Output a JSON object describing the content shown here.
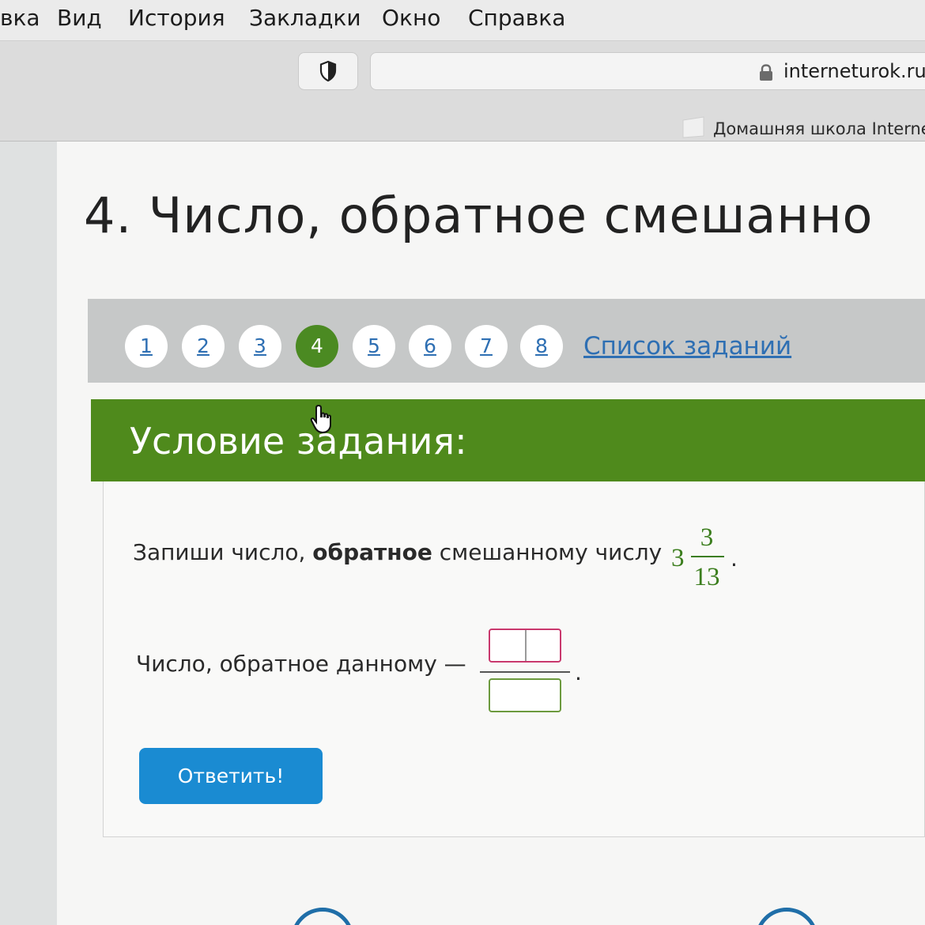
{
  "menubar": {
    "items": [
      "вка",
      "Вид",
      "История",
      "Закладки",
      "Окно",
      "Справка"
    ]
  },
  "browser": {
    "url": "interneturok.ru",
    "bookmark": "Домашняя школа Interne"
  },
  "page": {
    "title": "4. Число, обратное смешанно",
    "task_nav": {
      "numbers": [
        "1",
        "2",
        "3",
        "4",
        "5",
        "6",
        "7",
        "8"
      ],
      "active": "4",
      "task_list_label": "Список заданий"
    },
    "condition_header": "Условие задания:",
    "question": {
      "before": "Запиши число, ",
      "bold": "обратное",
      "after": " смешанному числу",
      "mixed_whole": "3",
      "mixed_numerator": "3",
      "mixed_denominator": "13",
      "end": "."
    },
    "answer": {
      "label": "Число, обратное данному —",
      "end": ".",
      "numerator_value": "",
      "denominator_value": ""
    },
    "submit_label": "Ответить!"
  },
  "colors": {
    "accent_green": "#4f8a1c",
    "link_blue": "#2e6fb3",
    "button_blue": "#1a8bd2",
    "numerator_border": "#c9386d",
    "denominator_border": "#6c9a3e"
  }
}
